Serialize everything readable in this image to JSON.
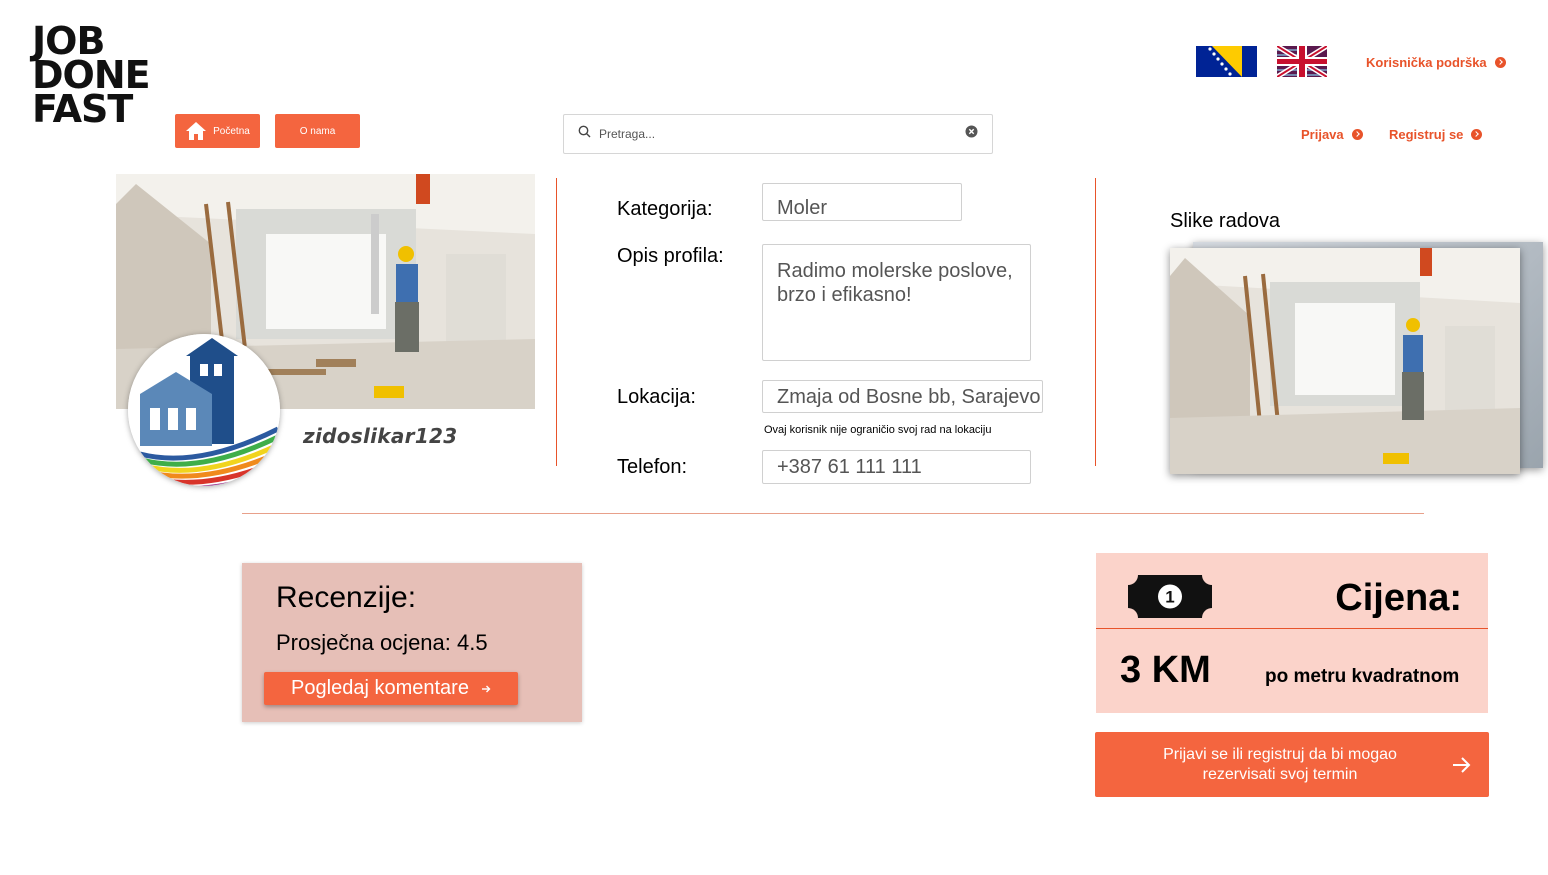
{
  "brand": {
    "logo_lines": [
      "JOB",
      "DONE",
      "FAST"
    ]
  },
  "nav": {
    "home_label": "Početna",
    "about_label": "O nama"
  },
  "search": {
    "placeholder": "Pretraga..."
  },
  "header": {
    "support_label": "Korisnička podrška",
    "login_label": "Prijava",
    "register_label": "Registruj se",
    "languages": [
      "bs",
      "en"
    ]
  },
  "profile": {
    "username": "zidoslikar123",
    "fields": {
      "category_label": "Kategorija:",
      "category_value": "Moler",
      "description_label": "Opis profila:",
      "description_value": "Radimo molerske poslove, brzo i efikasno!",
      "location_label": "Lokacija:",
      "location_value": "Zmaja od Bosne bb, Sarajevo",
      "location_note": "Ovaj korisnik nije ograničio svoj rad na lokaciju",
      "phone_label": "Telefon:",
      "phone_value": "+387 61 111 111"
    }
  },
  "gallery": {
    "title": "Slike radova"
  },
  "reviews": {
    "title": "Recenzije:",
    "average_text": "Prosječna ocjena: 4.5",
    "button_label": "Pogledaj komentare"
  },
  "price": {
    "title": "Cijena:",
    "amount": "3 KM",
    "unit": "po metru kvadratnom"
  },
  "cta": {
    "label": "Prijavi se ili registruj da bi mogao rezervisati svoj termin"
  },
  "colors": {
    "accent": "#f4653f",
    "accent_text": "#e8532a",
    "reviews_bg": "#e6bfb7",
    "price_bg": "#fbd3ca"
  },
  "icons": [
    "home-icon",
    "search-icon",
    "clear-icon",
    "bosnia-flag-icon",
    "uk-flag-icon",
    "arrow-circle-icon",
    "money-bill-icon",
    "arrow-right-icon",
    "house-logo-icon"
  ]
}
